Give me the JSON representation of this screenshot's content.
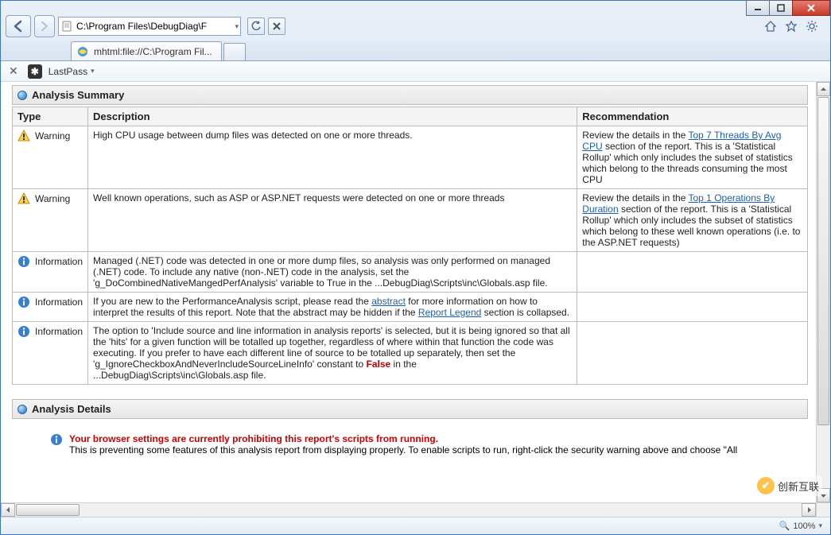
{
  "address_bar": {
    "path": "C:\\Program Files\\DebugDiag\\F"
  },
  "tab": {
    "title": "mhtml:file://C:\\Program Fil..."
  },
  "toolbar": {
    "lastpass": "LastPass"
  },
  "sections": {
    "summary_title": "Analysis Summary",
    "details_title": "Analysis Details"
  },
  "table": {
    "headers": {
      "type": "Type",
      "description": "Description",
      "recommendation": "Recommendation"
    },
    "rows": [
      {
        "icon": "warn",
        "type": "Warning",
        "desc": "High CPU usage between dump files was detected on one or more threads.",
        "rec_pre": "Review the details in the ",
        "rec_link": "Top 7 Threads By Avg CPU",
        "rec_post": " section of the report. This is a 'Statistical Rollup' which only includes the subset of statistics which belong to the threads consuming the most CPU"
      },
      {
        "icon": "warn",
        "type": "Warning",
        "desc": "Well known operations, such as ASP or ASP.NET requests were detected on one or more threads",
        "rec_pre": "Review the details in the ",
        "rec_link": "Top 1 Operations By Duration",
        "rec_post": " section of the report. This is a 'Statistical Rollup' which only includes the subset of statistics which belong to these well known operations (i.e. to the ASP.NET requests)"
      },
      {
        "icon": "info",
        "type": "Information",
        "desc": "Managed (.NET) code was detected in one or more dump files, so analysis was only performed on managed (.NET) code. To include any native (non-.NET) code in the analysis, set the 'g_DoCombinedNativeMangedPerfAnalysis' variable to True in the ...DebugDiag\\Scripts\\inc\\Globals.asp file.",
        "rec_pre": "",
        "rec_link": "",
        "rec_post": ""
      },
      {
        "icon": "info",
        "type": "Information",
        "desc_special": true,
        "d1": "If you are new to the PerformanceAnalysis script, please read the ",
        "d1l": "abstract",
        "d2": " for more information on how to interpret the results of this report.   Note that the abstract may be hidden if the ",
        "d2l": "Report Legend",
        "d3": " section is collapsed.",
        "rec_pre": "",
        "rec_link": "",
        "rec_post": ""
      },
      {
        "icon": "info",
        "type": "Information",
        "desc_special2": true,
        "e1": "The option to 'Include source and line information in analysis reports' is selected, but it is being ignored so that all the 'hits' for a given function will be totalled up together, regardless of where within that function the code was executing. If you prefer to have each different line of source to be totalled up separately, then set the 'g_IgnoreCheckboxAndNeverIncludeSourceLineInfo' constant to ",
        "e1f": "False",
        "e2": " in the ...DebugDiag\\Scripts\\inc\\Globals.asp file.",
        "rec_pre": "",
        "rec_link": "",
        "rec_post": ""
      }
    ]
  },
  "details_msg": {
    "line1": "Your browser settings are currently prohibiting this report's scripts from running.",
    "line2": "This is preventing some features of this analysis report from displaying properly. To enable scripts to run, right-click the security warning above and choose \"All"
  },
  "status": {
    "zoom": "100%"
  },
  "brand": {
    "text": "创新互联"
  }
}
